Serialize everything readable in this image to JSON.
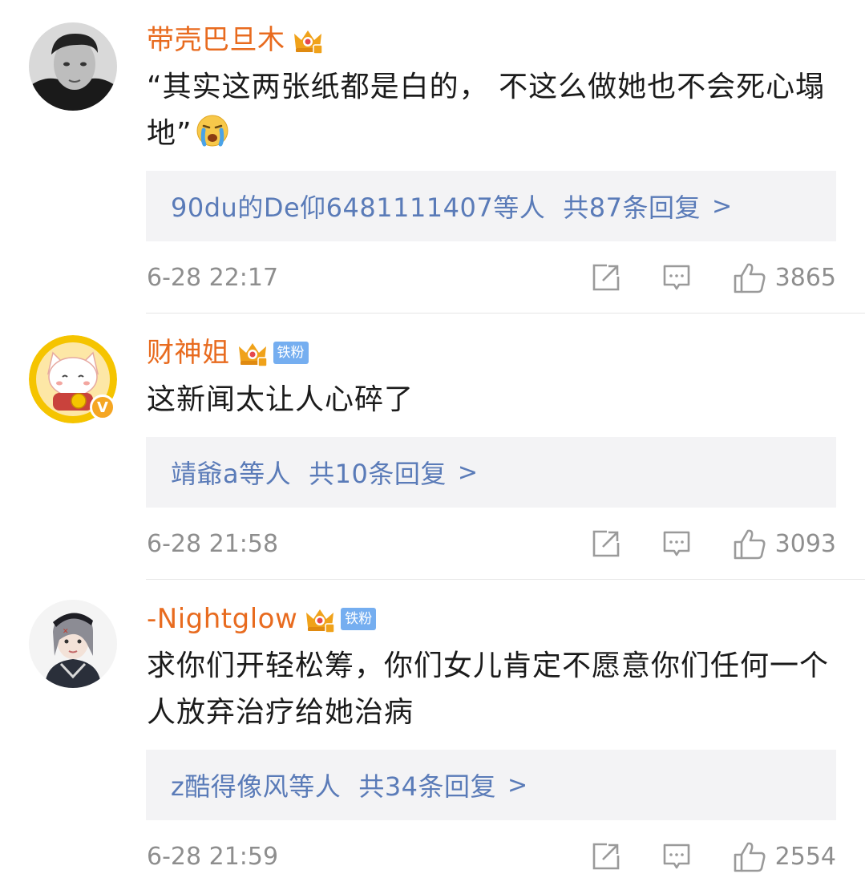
{
  "comments": [
    {
      "username": "带壳巴旦木",
      "fan_badge": "",
      "text": "“其实这两张纸都是白的， 不这么做她也不会死心塌地”",
      "emoji": "crying-emoji",
      "reply_users": "90du的De仰6481111407等人",
      "reply_total": "共87条回复",
      "reply_chevron": ">",
      "time": "6-28 22:17",
      "likes": "3865"
    },
    {
      "username": "财神姐",
      "fan_badge": "铁粉",
      "verified": "V",
      "text": "这新闻太让人心碎了",
      "reply_users": "靖爺a等人",
      "reply_total": "共10条回复",
      "reply_chevron": ">",
      "time": "6-28 21:58",
      "likes": "3093"
    },
    {
      "username": "-Nightglow",
      "fan_badge": "铁粉",
      "text": "求你们开轻松筹，你们女儿肯定不愿意你们任何一个人放弃治疗给她治病",
      "reply_users": "z酷得像风等人",
      "reply_total": "共34条回复",
      "reply_chevron": ">",
      "time": "6-28 21:59",
      "likes": "2554"
    }
  ],
  "colors": {
    "username": "#e86b1f",
    "reply_link": "#5a7bb8",
    "reply_bg": "#f3f3f5",
    "meta_text": "#8e8e8e",
    "fan_badge": "#75aef0",
    "crown": "#f0a21a"
  },
  "icons": {
    "crown": "vip-crown-icon",
    "share": "share-icon",
    "comment": "comment-icon",
    "like": "thumbs-up-icon"
  }
}
